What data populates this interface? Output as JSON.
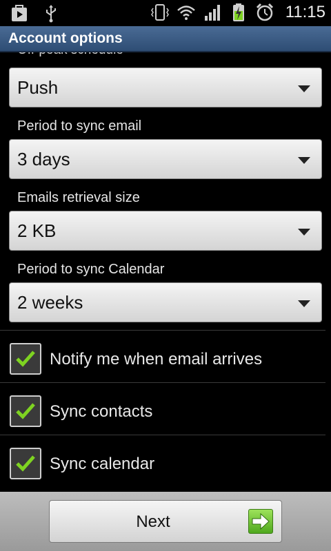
{
  "status_bar": {
    "time": "11:15",
    "left_icons": [
      "play-store-icon",
      "usb-icon"
    ],
    "right_icons": [
      "vibrate-icon",
      "wifi-icon",
      "signal-icon",
      "battery-charging-icon",
      "alarm-icon"
    ]
  },
  "title_bar": {
    "title": "Account options"
  },
  "settings": {
    "offpeak_label": "Off-peak schedule",
    "offpeak_value": "Push",
    "sync_email_label": "Period to sync email",
    "sync_email_value": "3 days",
    "retrieval_label": "Emails retrieval size",
    "retrieval_value": "2 KB",
    "sync_calendar_label": "Period to sync Calendar",
    "sync_calendar_value": "2 weeks"
  },
  "checkboxes": [
    {
      "label": "Notify me when email arrives",
      "checked": true
    },
    {
      "label": "Sync contacts",
      "checked": true
    },
    {
      "label": "Sync calendar",
      "checked": true
    }
  ],
  "colors": {
    "check_green": "#7ed321",
    "title_blue": "#3a5a84"
  },
  "bottom_bar": {
    "next_label": "Next",
    "next_icon": "arrow-right-icon"
  }
}
